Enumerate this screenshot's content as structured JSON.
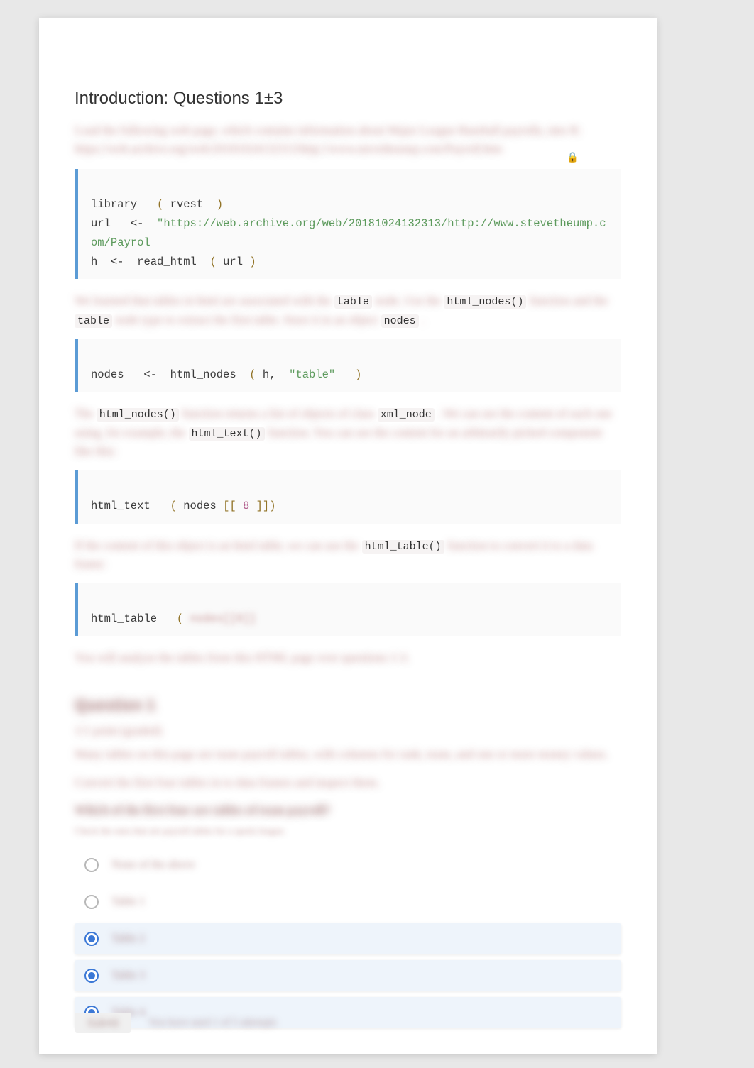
{
  "heading": "Introduction: Questions 1±3",
  "intro_para": "Load the following web page, which contains information about Major League Baseball payrolls, into R: https://web.archive.org/web/20181024132313/http://www.stevetheump.com/Payroll.htm",
  "lock_glyph": "🔒",
  "code1": {
    "l1_fn": "library",
    "l1_p1": "(",
    "l1_arg": "rvest",
    "l1_p2": ")",
    "l2_var": "url",
    "l2_op": "<-",
    "l2_str": "\"https://web.archive.org/web/20181024132313/http://www.stevetheump.com/Payrol",
    "l3_var": "h",
    "l3_op": "<-",
    "l3_fn": "read_html",
    "l3_p1": "(",
    "l3_arg": "url",
    "l3_p2": ")"
  },
  "para2_pre": "We learned that tables in html are associated with the ",
  "para2_c1": "table",
  "para2_mid1": " node.  Use the ",
  "para2_c2": "html_nodes()",
  "para2_mid2": " function and the ",
  "para2_c3": "table",
  "para2_mid3": " node type to extract the first table. Store it in an object ",
  "para2_c4": "nodes",
  "para2_end": " .",
  "code2": {
    "l1_var": "nodes",
    "l1_op": "<-",
    "l1_fn": "html_nodes",
    "l1_p1": "(",
    "l1_a1": "h",
    "l1_comma": ",",
    "l1_str": "\"table\"",
    "l1_p2": ")"
  },
  "para3_pre": "The ",
  "para3_c1": "html_nodes()",
  "para3_mid1": " function returns a list of objects of class ",
  "para3_c2": "xml_node",
  "para3_mid2": " . We can see the content of each one using, for example, the ",
  "para3_c3": "html_text()",
  "para3_end": " function. You can see the content for an arbitrarily picked component like this:",
  "code3": {
    "l1_fn": "html_text",
    "l1_p1": "(",
    "l1_arg": "nodes",
    "l1_br1": "[[",
    "l1_num": "8",
    "l1_br2": "]])"
  },
  "para4_pre": "If the content of this object is an html table, we can use the ",
  "para4_c1": "html_table()",
  "para4_end": " function to convert it to a data frame:",
  "code4": {
    "l1_fn": "html_table",
    "l1_p1": "(",
    "l1_arg_blurred": "nodes[[8]]",
    "l1_p2": ""
  },
  "para5": "You will analyze the tables from this HTML page over questions 1-3.",
  "q1_head": "Question 1",
  "q1_l1": "1/1 point (graded)",
  "q1_l2": "Many tables on this page are team payroll tables, with columns for rank, team, and one or more money values.",
  "q1_l3": "Convert the first four tables in        to data frames and inspect them.",
  "q1_l4": "Which of the first four        are tables of team payroll?",
  "q1_l5": "Check the ones that are payroll tables for a sports league.",
  "answers": [
    {
      "label": "None of the above",
      "selected": false
    },
    {
      "label": "Table 1",
      "selected": false
    },
    {
      "label": "Table 2",
      "selected": true
    },
    {
      "label": "Table 3",
      "selected": true
    },
    {
      "label": "Table 4",
      "selected": true
    }
  ],
  "footer_btn": "Submit",
  "footer_text": "You have used 1 of 5 attempts"
}
